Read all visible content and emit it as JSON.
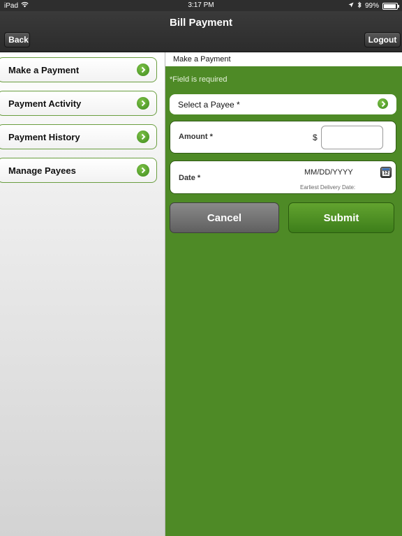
{
  "status_bar": {
    "device": "iPad",
    "time": "3:17 PM",
    "battery": "99%",
    "battery_level": 0.99
  },
  "nav": {
    "title": "Bill Payment",
    "back_label": "Back",
    "logout_label": "Logout"
  },
  "sidebar": {
    "items": [
      {
        "label": "Make a Payment"
      },
      {
        "label": "Payment Activity"
      },
      {
        "label": "Payment History"
      },
      {
        "label": "Manage Payees"
      }
    ]
  },
  "main": {
    "header": "Make a Payment",
    "required_note": "*Field is required",
    "payee_label": "Select a Payee *",
    "amount_label": "Amount *",
    "currency_symbol": "$",
    "amount_value": "",
    "date_label": "Date *",
    "date_placeholder": "MM/DD/YYYY",
    "earliest_delivery": "Earliest Delivery Date:",
    "calendar_day": "12",
    "cancel_label": "Cancel",
    "submit_label": "Submit"
  },
  "colors": {
    "accent_green": "#4e8a26",
    "chevron_green": "#3c8a1c",
    "nav_dark": "#2e2e2e"
  }
}
